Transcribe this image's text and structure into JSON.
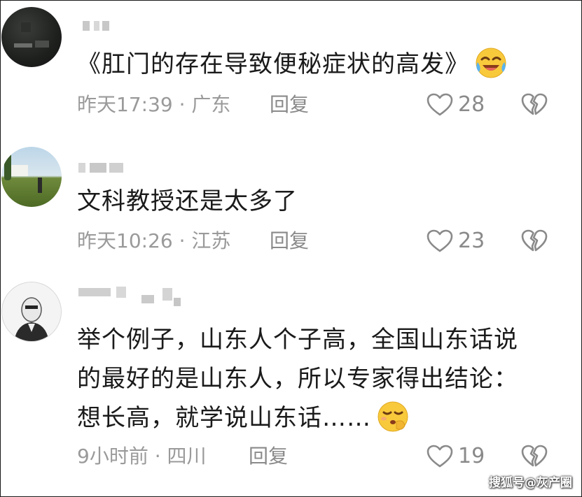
{
  "comments": [
    {
      "text": "《肛门的存在导致便秘症状的高发》",
      "emoji": "laughing-crying-emoji",
      "time_location": "昨天17:39 · 广东",
      "reply_label": "回复",
      "likes": "28"
    },
    {
      "text": "文科教授还是太多了",
      "time_location": "昨天10:26 · 江苏",
      "reply_label": "回复",
      "likes": "23"
    },
    {
      "lines": [
        "举个例子，山东人个子高，全国山东话说",
        "的最好的是山东人，所以专家得出结论：",
        "想长高，就学说山东话……"
      ],
      "emoji": "thinking-shush-emoji",
      "time_location": "9小时前 · 四川",
      "reply_label": "回复",
      "likes": "19"
    }
  ],
  "watermark": "搜狐号@灰产圈",
  "colors": {
    "text": "#1a1a1a",
    "meta": "#9a9a9a",
    "icon": "#8a8a8a"
  }
}
